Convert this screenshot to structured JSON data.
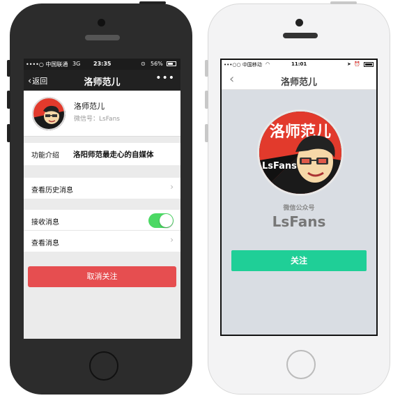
{
  "left_phone": {
    "status": {
      "carrier": "••••○ 中国联通",
      "network": "3G",
      "time": "23:35",
      "battery": "56%"
    },
    "nav": {
      "back_label": "返回",
      "title": "洛师范儿",
      "more": "•••"
    },
    "profile": {
      "name": "洛师范儿",
      "wechat_id": "微信号：LsFans"
    },
    "intro": {
      "label": "功能介绍",
      "value": "洛阳师范最走心的自媒体"
    },
    "history": {
      "label": "查看历史消息"
    },
    "receive": {
      "label": "接收消息",
      "enabled": true
    },
    "view": {
      "label": "查看消息"
    },
    "unfollow_label": "取消关注",
    "colors": {
      "unfollow": "#e64e50",
      "toggle_on": "#4cd964"
    }
  },
  "right_phone": {
    "status": {
      "carrier": "•••○○ 中国移动",
      "time": "11:01"
    },
    "nav": {
      "title": "洛师范儿"
    },
    "account_type": "微信公众号",
    "account_name": "LsFans",
    "follow_label": "关注",
    "colors": {
      "follow": "#1fcf97"
    }
  },
  "avatar": {
    "big_text": "洛师范儿",
    "small_text": "LsFans"
  }
}
